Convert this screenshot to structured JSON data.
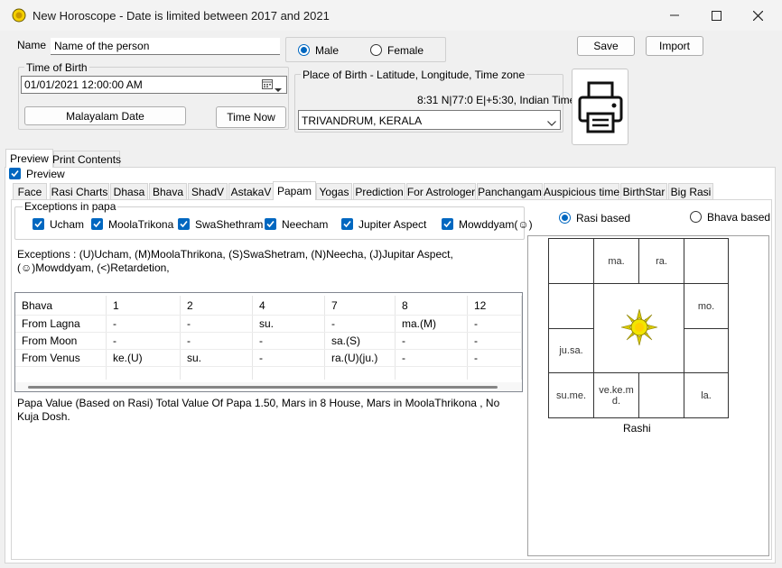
{
  "window": {
    "title": "New Horoscope - Date is limited between 2017 and 2021"
  },
  "form": {
    "name_label": "Name",
    "name_value": "Name of the person",
    "gender": {
      "male": "Male",
      "female": "Female",
      "selected": "Male"
    },
    "save": "Save",
    "import": "Import",
    "time_of_birth_title": "Time of Birth",
    "datetime_value": "01/01/2021  12:00:00 AM",
    "malayalam_date": "Malayalam Date",
    "time_now": "Time Now",
    "place_title": "Place of Birth - Latitude, Longitude, Time zone",
    "coordinates": "8:31 N|77:0 E|+5:30, Indian Time",
    "place_value": "TRIVANDRUM, KERALA"
  },
  "outer_tabs": [
    {
      "label": "Preview",
      "selected": true
    },
    {
      "label": "Print Contents",
      "selected": false
    }
  ],
  "preview_check": "Preview",
  "inner_tabs": [
    {
      "label": "Face"
    },
    {
      "label": "Rasi Charts"
    },
    {
      "label": "Dhasa"
    },
    {
      "label": "Bhava"
    },
    {
      "label": "ShadV"
    },
    {
      "label": "AstakaV"
    },
    {
      "label": "Papam"
    },
    {
      "label": "Yogas"
    },
    {
      "label": "Prediction"
    },
    {
      "label": "For Astrologer"
    },
    {
      "label": "Panchangam"
    },
    {
      "label": "Auspicious time"
    },
    {
      "label": "BirthStar"
    },
    {
      "label": "Big Rasi"
    }
  ],
  "selected_inner_tab": "Papam",
  "exceptions": {
    "title": "Exceptions in papa",
    "items": [
      "Ucham",
      "MoolaTrikona",
      "SwaShethram",
      "Neecham",
      "Jupiter Aspect",
      "Mowddyam(☺)"
    ],
    "legend_line1": "Exceptions : (U)Ucham,  (M)MoolaThrikona,  (S)SwaShetram,  (N)Neecha,  (J)Jupitar Aspect,",
    "legend_line2": "(☺)Mowddyam,  (<)Retardetion,"
  },
  "grid": {
    "columns": [
      "Bhava",
      "1",
      "2",
      "4",
      "7",
      "8",
      "12"
    ],
    "rows": [
      [
        "From Lagna",
        "-",
        "-",
        "su.",
        "-",
        "ma.(M)",
        "-"
      ],
      [
        "From Moon",
        "-",
        "-",
        "-",
        "sa.(S)",
        "-",
        "-"
      ],
      [
        "From Venus",
        "ke.(U)",
        "su.",
        "-",
        "ra.(U)(ju.)",
        "-",
        "-"
      ]
    ]
  },
  "papa_value_line1": "Papa Value (Based on Rasi) Total Value Of Papa  1.50,  Mars in  8 House,  Mars in  MoolaThrikona , No",
  "papa_value_line2": "Kuja Dosh.",
  "chart_panel": {
    "rasi_based": "Rasi based",
    "bhava_based": "Bhava based",
    "selected": "Rasi based",
    "caption": "Rashi",
    "houses": {
      "top_1": "",
      "top_2": "ma.",
      "top_3": "ra.",
      "top_4": "",
      "right_1": "mo.",
      "right_2": "",
      "bottom_4": "la.",
      "bottom_3": "",
      "bottom_2": "ve.ke.m d.",
      "bottom_1": "su.me.",
      "left_2": "ju.sa.",
      "left_1": ""
    }
  }
}
